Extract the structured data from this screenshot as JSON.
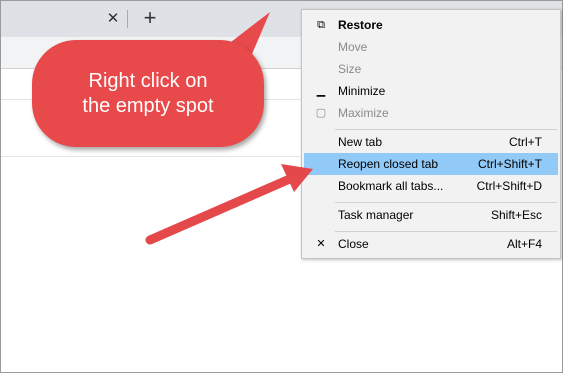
{
  "tabstrip": {
    "close_tab_glyph": "✕",
    "new_tab_glyph": "+"
  },
  "context_menu": {
    "items": [
      {
        "label": "Restore",
        "shortcut": "",
        "icon": "restore-icon",
        "state": "bold"
      },
      {
        "label": "Move",
        "shortcut": "",
        "icon": "",
        "state": "disabled"
      },
      {
        "label": "Size",
        "shortcut": "",
        "icon": "",
        "state": "disabled"
      },
      {
        "label": "Minimize",
        "shortcut": "",
        "icon": "minimize-icon",
        "state": "normal"
      },
      {
        "label": "Maximize",
        "shortcut": "",
        "icon": "maximize-icon",
        "state": "disabled"
      },
      {
        "label": "New tab",
        "shortcut": "Ctrl+T",
        "icon": "",
        "state": "normal"
      },
      {
        "label": "Reopen closed tab",
        "shortcut": "Ctrl+Shift+T",
        "icon": "",
        "state": "highlighted"
      },
      {
        "label": "Bookmark all tabs...",
        "shortcut": "Ctrl+Shift+D",
        "icon": "",
        "state": "normal"
      },
      {
        "label": "Task manager",
        "shortcut": "Shift+Esc",
        "icon": "",
        "state": "normal"
      },
      {
        "label": "Close",
        "shortcut": "Alt+F4",
        "icon": "close-icon",
        "state": "normal"
      }
    ],
    "icon_glyphs": {
      "restore": "⧉",
      "minimize": "▁",
      "maximize": "▢",
      "close": "✕"
    }
  },
  "annotation": {
    "line1": "Right click on",
    "line2": "the empty spot",
    "color": "#e84a4b"
  },
  "colors": {
    "highlight": "#91c9f7",
    "menu_bg": "#f2f2f2",
    "tabstrip_bg": "#dee1e6"
  }
}
